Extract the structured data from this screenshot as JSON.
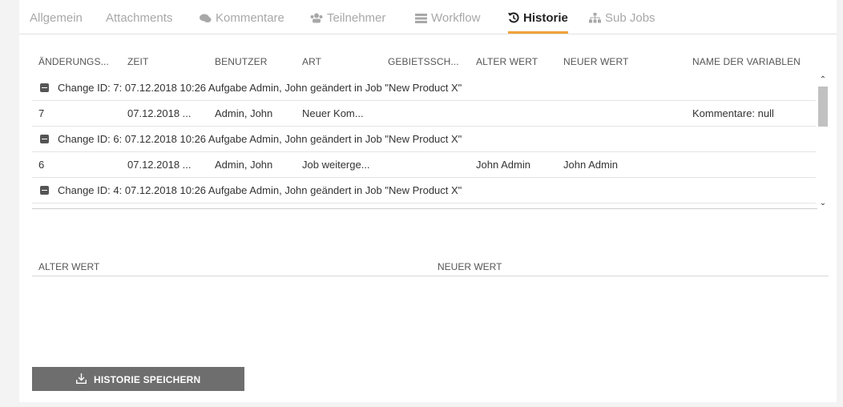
{
  "tabs": [
    {
      "label": "Allgemein",
      "icon": "",
      "active": false
    },
    {
      "label": "Attachments",
      "icon": "",
      "active": false
    },
    {
      "label": "Kommentare",
      "icon": "comments-icon",
      "active": false
    },
    {
      "label": "Teilnehmer",
      "icon": "users-icon",
      "active": false
    },
    {
      "label": "Workflow",
      "icon": "list-icon",
      "active": false
    },
    {
      "label": "Historie",
      "icon": "history-icon",
      "active": true
    },
    {
      "label": "Sub Jobs",
      "icon": "sitemap-icon",
      "active": false
    }
  ],
  "accent_color": "#f0a23b",
  "grid": {
    "headers": [
      "ÄNDERUNGS...",
      "ZEIT",
      "BENUTZER",
      "ART",
      "GEBIETSSCH...",
      "ALTER WERT",
      "NEUER WERT",
      "NAME DER VARIABLEN"
    ],
    "groups": [
      {
        "text": "Change ID: 7: 07.12.2018 10:26 Aufgabe Admin, John geändert in Job \"New Product X\""
      },
      {
        "text": "Change ID: 6: 07.12.2018 10:26 Aufgabe Admin, John geändert in Job \"New Product X\""
      },
      {
        "text": "Change ID: 4: 07.12.2018 10:26 Aufgabe Admin, John geändert in Job \"New Product X\""
      }
    ],
    "rows": [
      {
        "id": "7",
        "zeit": "07.12.2018 ...",
        "benutzer": "Admin, John",
        "art": "Neuer Kom...",
        "gebiet": "",
        "alter": "",
        "neuer": "",
        "variable": "Kommentare: null"
      },
      {
        "id": "6",
        "zeit": "07.12.2018 ...",
        "benutzer": "Admin, John",
        "art": "Job weiterge...",
        "gebiet": "",
        "alter": "John Admin",
        "neuer": "John Admin",
        "variable": ""
      }
    ]
  },
  "detail": {
    "old_value_label": "ALTER WERT",
    "new_value_label": "NEUER WERT"
  },
  "save_button": {
    "label": "HISTORIE SPEICHERN",
    "icon": "download-icon",
    "color": "#6e6e6e"
  }
}
